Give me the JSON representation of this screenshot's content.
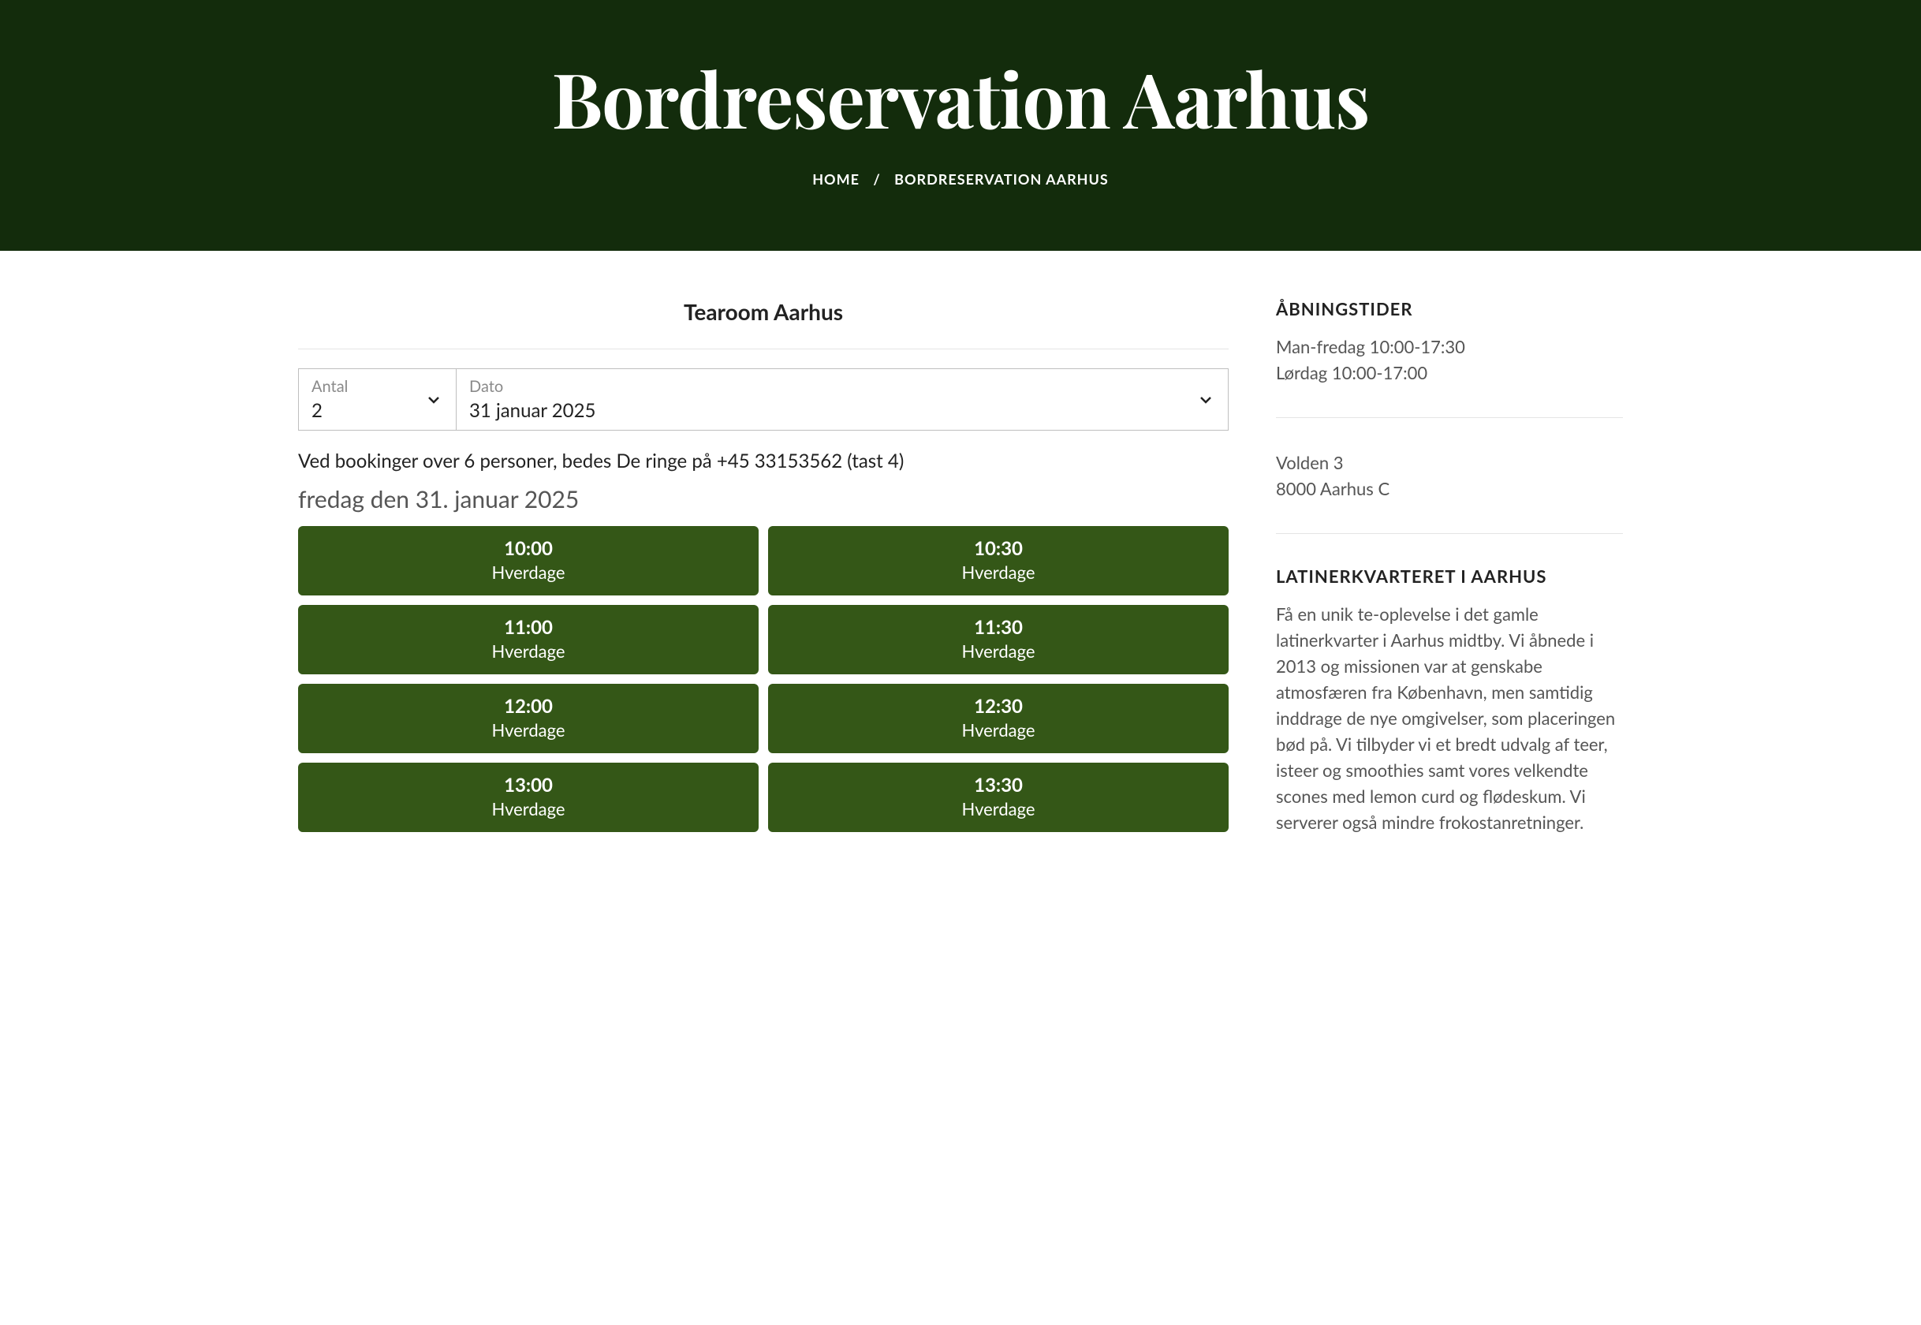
{
  "hero": {
    "title": "Bordreservation Aarhus",
    "breadcrumb_home": "HOME",
    "breadcrumb_sep": "/",
    "breadcrumb_current": "BORDRESERVATION AARHUS"
  },
  "booking": {
    "venue_title": "Tearoom Aarhus",
    "antal_label": "Antal",
    "antal_value": "2",
    "dato_label": "Dato",
    "dato_value": "31 januar 2025",
    "note": "Ved bookinger over 6 personer, bedes De ringe på +45 33153562 (tast 4)",
    "date_heading": "fredag den 31. januar 2025",
    "slots": [
      {
        "time": "10:00",
        "sub": "Hverdage"
      },
      {
        "time": "10:30",
        "sub": "Hverdage"
      },
      {
        "time": "11:00",
        "sub": "Hverdage"
      },
      {
        "time": "11:30",
        "sub": "Hverdage"
      },
      {
        "time": "12:00",
        "sub": "Hverdage"
      },
      {
        "time": "12:30",
        "sub": "Hverdage"
      },
      {
        "time": "13:00",
        "sub": "Hverdage"
      },
      {
        "time": "13:30",
        "sub": "Hverdage"
      }
    ]
  },
  "sidebar": {
    "hours_heading": "ÅBNINGSTIDER",
    "hours_line1": "Man-fredag 10:00-17:30",
    "hours_line2": "Lørdag 10:00-17:00",
    "address_line1": "Volden 3",
    "address_line2": "8000 Aarhus C",
    "latin_heading": "LATINERKVARTERET I AARHUS",
    "latin_body": "Få en unik te-oplevelse i det gamle latinerkvarter i Aarhus midtby. Vi åbnede i 2013 og missionen var at genskabe atmosfæren fra København, men samtidig inddrage de nye omgivelser, som placeringen bød på. Vi tilbyder vi et bredt udvalg af teer, isteer og smoothies samt vores velkendte scones med lemon curd og flødeskum. Vi serverer også mindre frokostanretninger."
  }
}
